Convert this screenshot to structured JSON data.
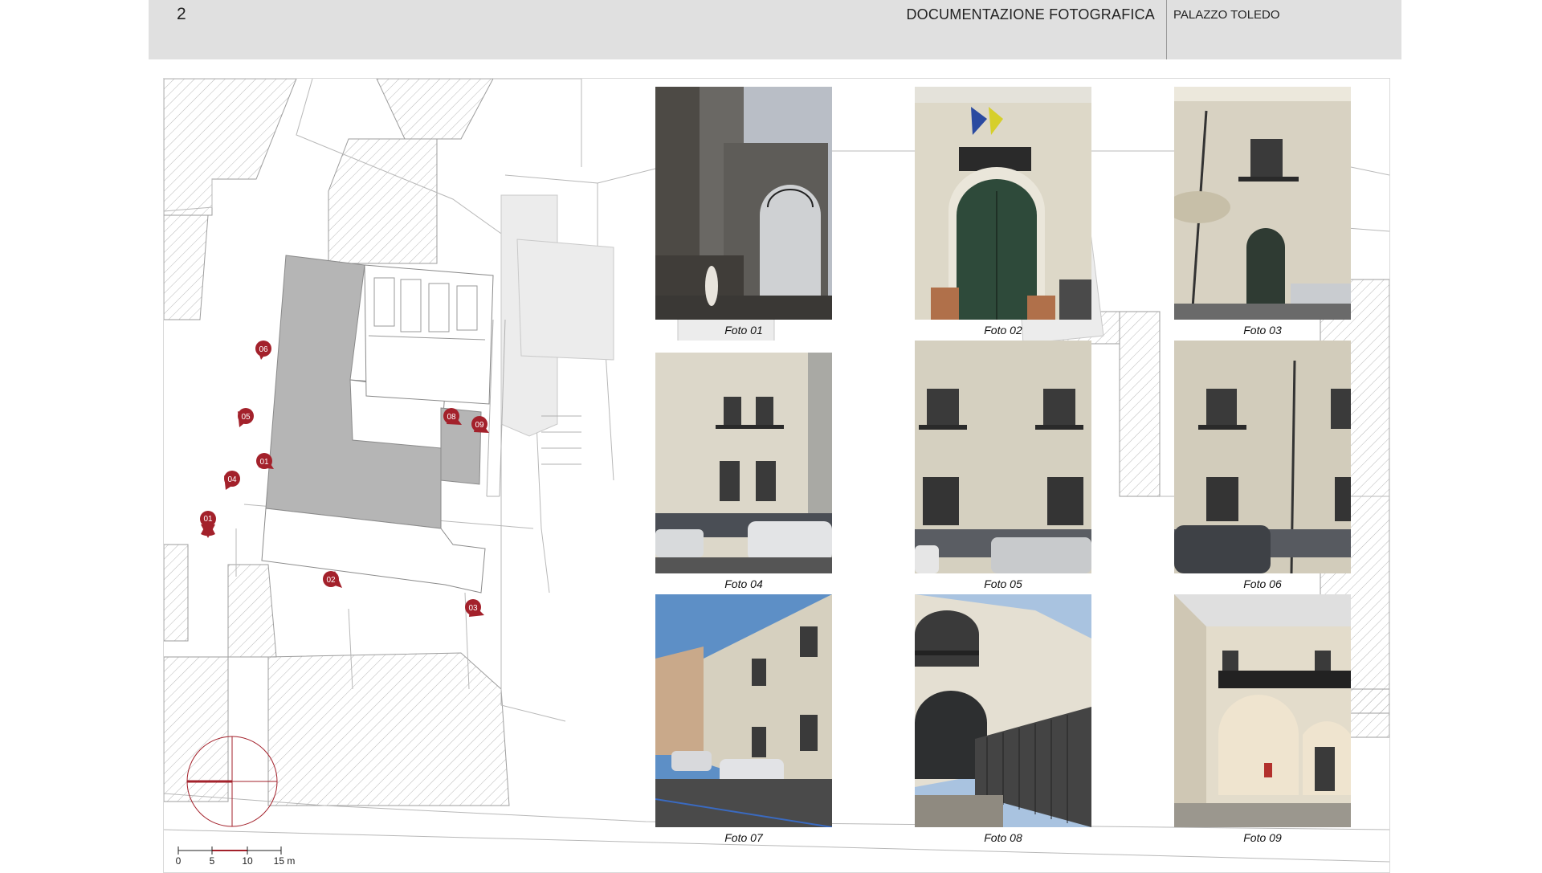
{
  "header": {
    "page_number": "2",
    "title": "DOCUMENTAZIONE FOTOGRAFICA",
    "building": "PALAZZO TOLEDO"
  },
  "plan": {
    "marker_color": "#a3212b",
    "markers": [
      {
        "label": "01"
      },
      {
        "label": "02"
      },
      {
        "label": "03"
      },
      {
        "label": "04"
      },
      {
        "label": "05"
      },
      {
        "label": "06"
      },
      {
        "label": "01"
      },
      {
        "label": "08"
      },
      {
        "label": "09"
      }
    ],
    "scale_bar": {
      "ticks": [
        "0",
        "5",
        "10",
        "15 m"
      ]
    },
    "north_arrow_icon": "north-arrow-compass-icon"
  },
  "photos": [
    {
      "caption": "Foto 01"
    },
    {
      "caption": "Foto 02"
    },
    {
      "caption": "Foto 03"
    },
    {
      "caption": "Foto 04"
    },
    {
      "caption": "Foto 05"
    },
    {
      "caption": "Foto 06"
    },
    {
      "caption": "Foto 07"
    },
    {
      "caption": "Foto 08"
    },
    {
      "caption": "Foto 09"
    }
  ]
}
